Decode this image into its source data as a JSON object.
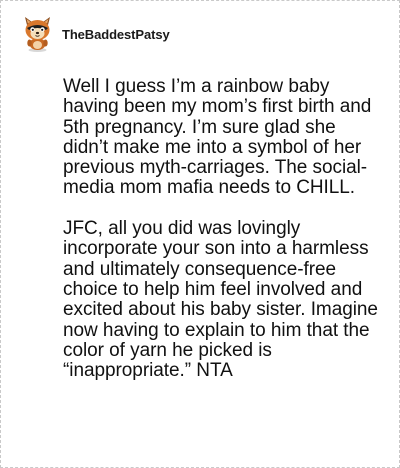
{
  "post": {
    "username": "TheBaddestPatsy",
    "avatar_icon": "fox-avatar-icon",
    "paragraphs": [
      "Well I guess I’m a rainbow baby having been my mom’s first birth and 5th pregnancy. I’m sure glad she didn’t make me into a symbol of her previous myth-carriages. The social-media mom mafia needs to CHILL.",
      "JFC, all you did was lovingly incorporate your son into a harmless and ultimately consequence-free choice to help him feel involved and excited about his baby sister. Imagine now having to explain to him that the color of yarn he picked is “inappropriate.” NTA"
    ]
  }
}
